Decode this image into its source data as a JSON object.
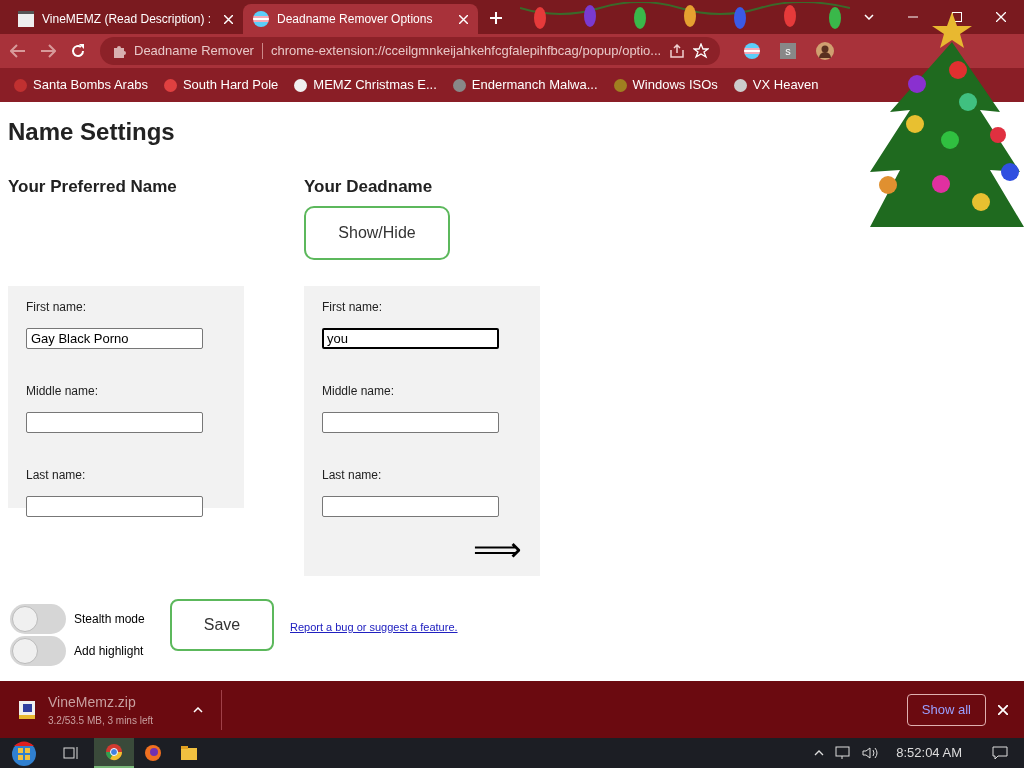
{
  "browser": {
    "tabs": [
      {
        "title": "VineMEMZ (Read Description) :",
        "selected": false
      },
      {
        "title": "Deadname Remover Options",
        "selected": true
      }
    ],
    "address": {
      "site_label": "Deadname Remover",
      "url": "chrome-extension://cceilgmnkeijahkehfcgfalepihfbcag/popup/optio..."
    },
    "extension_badge": "s",
    "bookmarks": [
      "Santa Bombs Arabs",
      "South Hard Pole",
      "MEMZ Christmas E...",
      "Endermanch Malwa...",
      "Windows ISOs",
      "VX Heaven"
    ]
  },
  "page": {
    "heading": "Name Settings",
    "preferred": {
      "title": "Your Preferred Name",
      "fields": [
        {
          "label": "First name:",
          "value": "Gay Black Porno",
          "focused": false
        },
        {
          "label": "Middle name:",
          "focused": false
        },
        {
          "label": "Last name:",
          "focused": false
        }
      ]
    },
    "deadname": {
      "title": "Your Deadname",
      "show_hide_button": "Show/Hide",
      "arrow": "⟹",
      "fields": [
        {
          "label": "First name:",
          "value": "you",
          "focused": true
        },
        {
          "label": "Middle name:",
          "focused": false
        },
        {
          "label": "Last name:",
          "focused": false
        }
      ]
    },
    "save_button": "Save",
    "toggles": [
      {
        "label": "Stealth mode",
        "on": false
      },
      {
        "label": "Add highlight",
        "on": false
      }
    ],
    "report_link": "Report a bug or suggest a feature."
  },
  "download_bar": {
    "file": "VineMemz.zip",
    "status": "3.2/53.5 MB, 3 mins left",
    "show_all": "Show all"
  },
  "taskbar": {
    "clock": "8:52:04 AM"
  }
}
